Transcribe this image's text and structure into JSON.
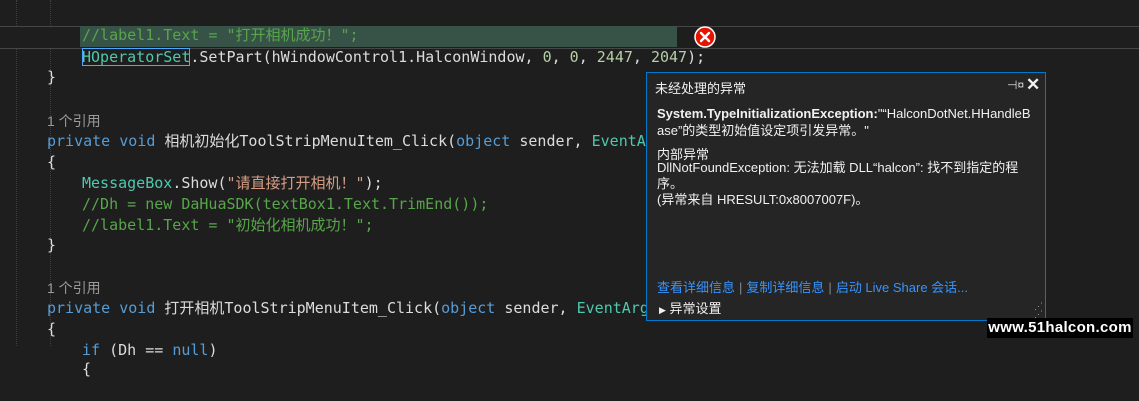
{
  "code": {
    "line0": "//label1.Text = \"打开相机成功！\";",
    "line1_a": "HOperatorSet",
    "line1_b": ".SetPart(hWindowControl1.HalconWindow, ",
    "line1_n1": "0",
    "line1_c1": ", ",
    "line1_n2": "0",
    "line1_c2": ", ",
    "line1_n3": "2447",
    "line1_c3": ", ",
    "line1_n4": "2047",
    "line1_end": ");",
    "brace_close1": "}",
    "ref1": "1 个引用",
    "m1_private": "private",
    "m1_void": "void",
    "m1_name": " 相机初始化ToolStripMenuItem_Click(",
    "m1_object": "object",
    "m1_sender": " sender, ",
    "m1_args": "EventArgs",
    "brace_open1": "{",
    "l_msg_a": "MessageBox",
    "l_msg_b": ".Show(",
    "l_msg_str": "\"请直接打开相机！\"",
    "l_msg_end": ");",
    "l_dh": "//Dh = new DaHuaSDK(textBox1.Text.TrimEnd());",
    "l_label": "//label1.Text = \"初始化相机成功！\";",
    "brace_close2": "}",
    "ref2": "1 个引用",
    "m2_private": "private",
    "m2_void": "void",
    "m2_name": " 打开相机ToolStripMenuItem_Click(",
    "m2_object": "object",
    "m2_sender": " sender, ",
    "m2_args": "EventArgs",
    "brace_open2": "{",
    "if_kw": "if",
    "if_a": " (Dh == ",
    "if_null": "null",
    "if_b": ")",
    "brace_open3": "{"
  },
  "popup": {
    "title": "未经处理的异常",
    "pin_icon": "pin-icon",
    "close_icon": "close-icon",
    "exception_type": "System.TypeInitializationException:",
    "exception_msg_1": "\"“HalconDotNet.HHandleB",
    "exception_msg_2": "ase”的类型初始值设定项引发异常。\"",
    "inner_title": "内部异常",
    "inner_line1": "DllNotFoundException: 无法加载 DLL“halcon”: 找不到指定的程序。",
    "inner_line2": "(异常来自 HRESULT:0x8007007F)。",
    "link_details": "查看详细信息",
    "link_copy": "复制详细信息",
    "link_liveshare": "启动 Live Share 会话...",
    "settings_label": "异常设置"
  },
  "watermark": "www.51halcon.com",
  "colors": {
    "background": "#1e1e1e",
    "keyword": "#569cd6",
    "type": "#4ec9b0",
    "comment": "#57a64a",
    "string": "#d69d85",
    "number": "#b5cea8",
    "link": "#3794ff",
    "error": "#e51400",
    "popup_border": "#007acc"
  }
}
